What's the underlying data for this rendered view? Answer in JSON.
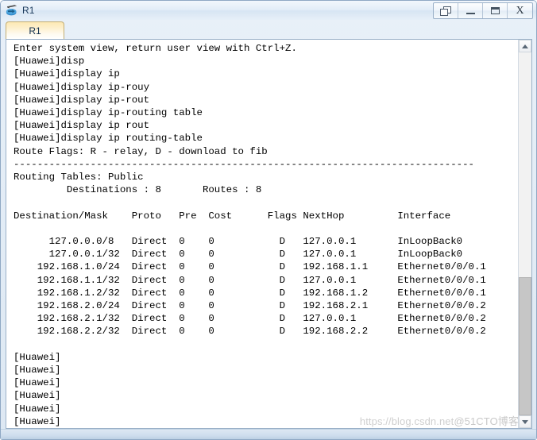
{
  "window": {
    "title": "R1",
    "icon": "router-icon",
    "buttons": [
      {
        "name": "cascade-button",
        "label": ""
      },
      {
        "name": "minimize-button",
        "label": ""
      },
      {
        "name": "maximize-button",
        "label": ""
      },
      {
        "name": "close-button",
        "label": "X"
      }
    ]
  },
  "tabs": [
    {
      "label": "R1",
      "active": true
    }
  ],
  "terminal": {
    "lines": [
      "Enter system view, return user view with Ctrl+Z.",
      "[Huawei]disp",
      "[Huawei]display ip",
      "[Huawei]display ip-rouy",
      "[Huawei]display ip-rout",
      "[Huawei]display ip-routing table",
      "[Huawei]display ip rout",
      "[Huawei]display ip routing-table",
      "Route Flags: R - relay, D - download to fib",
      "------------------------------------------------------------------------------",
      "Routing Tables: Public",
      "         Destinations : 8       Routes : 8",
      "",
      "Destination/Mask    Proto   Pre  Cost      Flags NextHop         Interface",
      "",
      "      127.0.0.0/8   Direct  0    0           D   127.0.0.1       InLoopBack0",
      "      127.0.0.1/32  Direct  0    0           D   127.0.0.1       InLoopBack0",
      "    192.168.1.0/24  Direct  0    0           D   192.168.1.1     Ethernet0/0/0.1",
      "    192.168.1.1/32  Direct  0    0           D   127.0.0.1       Ethernet0/0/0.1",
      "    192.168.1.2/32  Direct  0    0           D   192.168.1.2     Ethernet0/0/0.1",
      "    192.168.2.0/24  Direct  0    0           D   192.168.2.1     Ethernet0/0/0.2",
      "    192.168.2.1/32  Direct  0    0           D   127.0.0.1       Ethernet0/0/0.2",
      "    192.168.2.2/32  Direct  0    0           D   192.168.2.2     Ethernet0/0/0.2",
      "",
      "[Huawei]",
      "[Huawei]",
      "[Huawei]",
      "[Huawei]",
      "[Huawei]",
      "[Huawei]"
    ],
    "routing_table": {
      "flags_legend": "Route Flags: R - relay, D - download to fib",
      "table_name": "Routing Tables: Public",
      "destinations": "8",
      "routes": "8",
      "headers": [
        "Destination/Mask",
        "Proto",
        "Pre",
        "Cost",
        "Flags",
        "NextHop",
        "Interface"
      ],
      "rows": [
        [
          "127.0.0.0/8",
          "Direct",
          "0",
          "0",
          "D",
          "127.0.0.1",
          "InLoopBack0"
        ],
        [
          "127.0.0.1/32",
          "Direct",
          "0",
          "0",
          "D",
          "127.0.0.1",
          "InLoopBack0"
        ],
        [
          "192.168.1.0/24",
          "Direct",
          "0",
          "0",
          "D",
          "192.168.1.1",
          "Ethernet0/0/0.1"
        ],
        [
          "192.168.1.1/32",
          "Direct",
          "0",
          "0",
          "D",
          "127.0.0.1",
          "Ethernet0/0/0.1"
        ],
        [
          "192.168.1.2/32",
          "Direct",
          "0",
          "0",
          "D",
          "192.168.1.2",
          "Ethernet0/0/0.1"
        ],
        [
          "192.168.2.0/24",
          "Direct",
          "0",
          "0",
          "D",
          "192.168.2.1",
          "Ethernet0/0/0.2"
        ],
        [
          "192.168.2.1/32",
          "Direct",
          "0",
          "0",
          "D",
          "127.0.0.1",
          "Ethernet0/0/0.2"
        ],
        [
          "192.168.2.2/32",
          "Direct",
          "0",
          "0",
          "D",
          "192.168.2.2",
          "Ethernet0/0/0.2"
        ]
      ]
    },
    "prompt": "[Huawei]"
  },
  "scrollbar": {
    "up_arrow": "scroll-up-icon",
    "down_arrow": "scroll-down-icon",
    "thumb_top_pct": 62,
    "thumb_height_pct": 38
  },
  "watermark": {
    "url": "https://blog.csdn.net",
    "site": "@51CTO博客"
  }
}
